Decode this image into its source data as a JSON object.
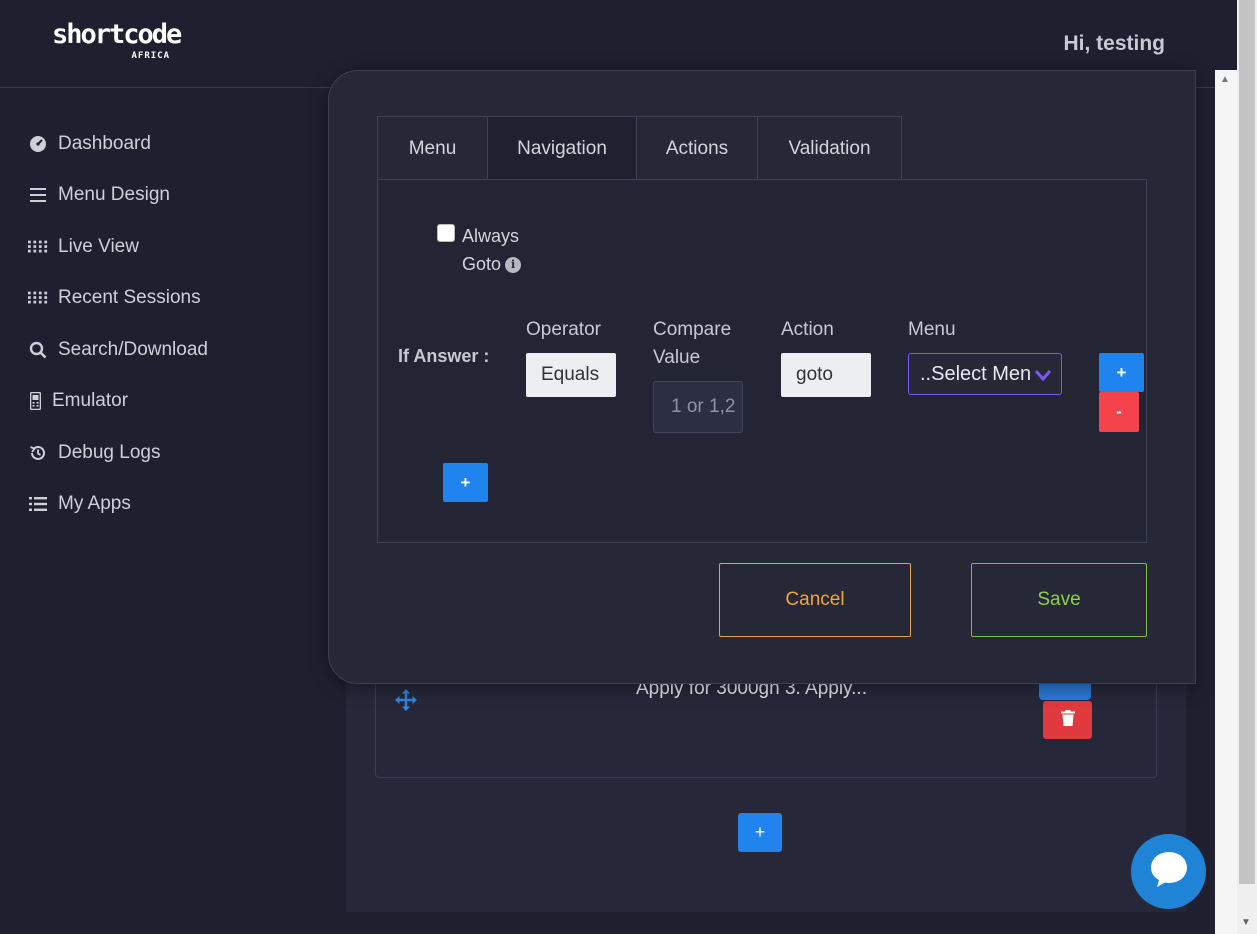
{
  "header": {
    "logo_text": "shortcode",
    "logo_sub": "AFRICA",
    "greeting": "Hi, testing"
  },
  "sidebar": {
    "items": [
      {
        "label": "Dashboard",
        "icon": "gauge-icon"
      },
      {
        "label": "Menu Design",
        "icon": "hamburger-icon"
      },
      {
        "label": "Live View",
        "icon": "grid-icon"
      },
      {
        "label": "Recent Sessions",
        "icon": "grid-icon"
      },
      {
        "label": "Search/Download",
        "icon": "search-icon"
      },
      {
        "label": "Emulator",
        "icon": "phone-icon"
      },
      {
        "label": "Debug Logs",
        "icon": "history-icon"
      },
      {
        "label": "My Apps",
        "icon": "list-icon"
      }
    ]
  },
  "background_list": {
    "item_text": "Apply for 3000gh 3. Apply...",
    "add_label": "+"
  },
  "modal": {
    "tabs": [
      "Menu",
      "Navigation",
      "Actions",
      "Validation"
    ],
    "active_tab": "Navigation",
    "always_goto_label": "Always Goto",
    "always_goto_checked": false,
    "info_icon_glyph": "i",
    "if_answer_label": "If Answer :",
    "columns": {
      "operator": "Operator",
      "compare_value": "Compare Value",
      "action": "Action",
      "menu": "Menu"
    },
    "row": {
      "operator_value": "Equals",
      "compare_placeholder": "1 or 1,2",
      "action_value": "goto",
      "menu_value": "..Select Menu"
    },
    "add_row_label": "+",
    "remove_row_label": "-",
    "add_condition_label": "+",
    "cancel_label": "Cancel",
    "save_label": "Save"
  },
  "colors": {
    "accent_blue": "#1f84ee",
    "danger_red": "#f4434b",
    "cancel_orange": "#f0a43c",
    "save_green": "#8bd14a",
    "select_border": "#7a5af5"
  }
}
